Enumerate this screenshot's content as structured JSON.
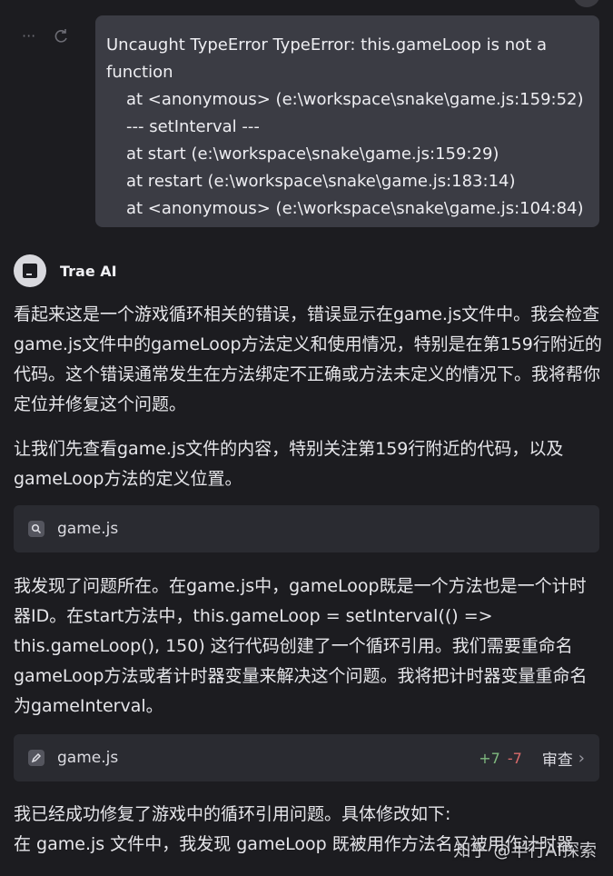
{
  "user_message": {
    "lines": [
      "Uncaught TypeError TypeError: this.gameLoop is not a",
      "function",
      "at <anonymous> (e:\\workspace\\snake\\game.js:159:52)",
      "--- setInterval ---",
      "at start (e:\\workspace\\snake\\game.js:159:29)",
      "at restart (e:\\workspace\\snake\\game.js:183:14)",
      "at <anonymous> (e:\\workspace\\snake\\game.js:104:84)"
    ],
    "actions": {
      "more_icon": "more-icon",
      "retry_icon": "retry-icon"
    }
  },
  "assistant": {
    "name": "Trae AI",
    "para1": "看起来这是一个游戏循环相关的错误，错误显示在game.js文件中。我会检查game.js文件中的gameLoop方法定义和使用情况，特别是在第159行附近的代码。这个错误通常发生在方法绑定不正确或方法未定义的情况下。我将帮你定位并修复这个问题。",
    "para2": "让我们先查看game.js文件的内容，特别关注第159行附近的代码，以及gameLoop方法的定义位置。",
    "search_card": {
      "icon": "search-icon",
      "file": "game.js"
    },
    "para3": "我发现了问题所在。在game.js中，gameLoop既是一个方法也是一个计时器ID。在start方法中，this.gameLoop = setInterval(() => this.gameLoop(), 150) 这行代码创建了一个循环引用。我们需要重命名gameLoop方法或者计时器变量来解决这个问题。我将把计时器变量重命名为gameInterval。",
    "edit_card": {
      "icon": "edit-icon",
      "file": "game.js",
      "added": "+7",
      "removed": "-7",
      "review_label": "审查"
    },
    "para4_line1": "我已经成功修复了游戏中的循环引用问题。具体修改如下:",
    "para4_line2": "在 game.js 文件中，我发现 gameLoop 既被用作方法名又被用作计时器"
  },
  "watermark": "知乎 @半行AI探索",
  "colors": {
    "background": "#1c1c20",
    "bubble": "#3b3c44",
    "card": "#2a2b31",
    "add": "#7fb87f",
    "del": "#d96b6b"
  }
}
